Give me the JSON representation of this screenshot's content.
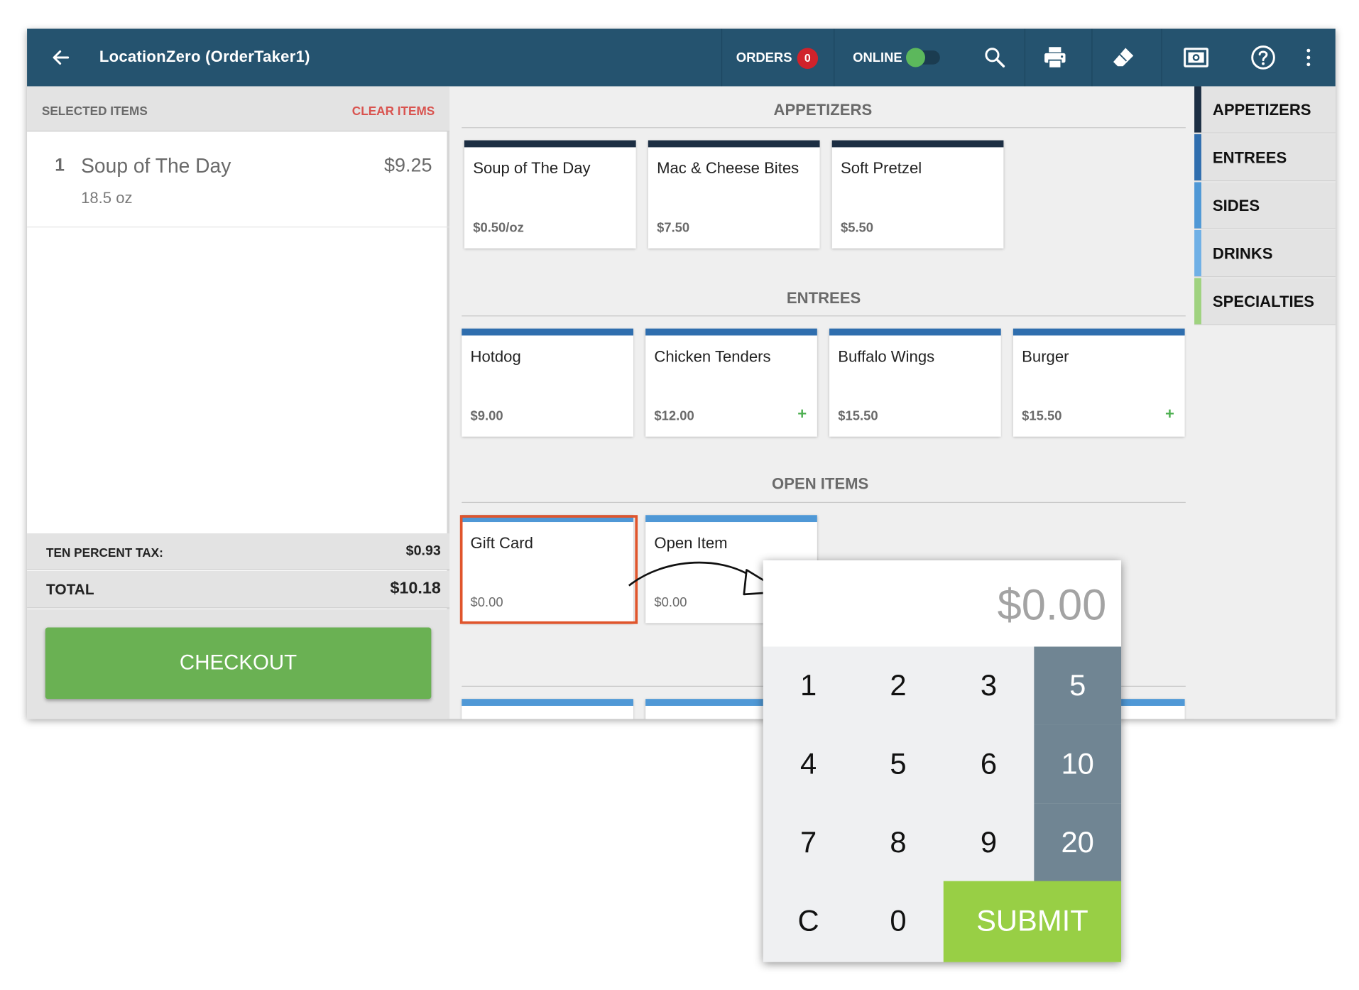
{
  "header": {
    "title": "LocationZero (OrderTaker1)",
    "orders_label": "ORDERS",
    "orders_count": "0",
    "online_label": "ONLINE",
    "online_on": true
  },
  "order": {
    "header_label": "SELECTED ITEMS",
    "clear_label": "CLEAR ITEMS",
    "items": [
      {
        "qty": "1",
        "name": "Soup of The Day",
        "price": "$9.25",
        "detail": "18.5 oz"
      }
    ],
    "tax_label": "TEN PERCENT TAX:",
    "tax_value": "$0.93",
    "total_label": "TOTAL",
    "total_value": "$10.18",
    "checkout_label": "CHECKOUT"
  },
  "sections": {
    "appetizers": {
      "title": "APPETIZERS",
      "items": [
        {
          "name": "Soup of The Day",
          "price": "$0.50/oz"
        },
        {
          "name": "Mac & Cheese Bites",
          "price": "$7.50"
        },
        {
          "name": "Soft Pretzel",
          "price": "$5.50"
        }
      ]
    },
    "entrees": {
      "title": "ENTREES",
      "items": [
        {
          "name": "Hotdog",
          "price": "$9.00",
          "plus": ""
        },
        {
          "name": "Chicken Tenders",
          "price": "$12.00",
          "plus": "+"
        },
        {
          "name": "Buffalo Wings",
          "price": "$15.50",
          "plus": ""
        },
        {
          "name": "Burger",
          "price": "$15.50",
          "plus": "+"
        }
      ]
    },
    "open_items": {
      "title": "OPEN ITEMS",
      "items": [
        {
          "name": "Gift Card",
          "price": "$0.00"
        },
        {
          "name": "Open Item",
          "price": "$0.00"
        }
      ]
    }
  },
  "categories": [
    {
      "label": "APPETIZERS",
      "color": "#1c2e43"
    },
    {
      "label": "ENTREES",
      "color": "#2f6eae"
    },
    {
      "label": "SIDES",
      "color": "#4f98d6"
    },
    {
      "label": "DRINKS",
      "color": "#6fb0e6"
    },
    {
      "label": "SPECIALTIES",
      "color": "#9fd27f"
    }
  ],
  "numpad": {
    "amount": "$0.00",
    "keys": [
      "1",
      "2",
      "3",
      "4",
      "5",
      "6",
      "7",
      "8",
      "9",
      "C",
      "0"
    ],
    "quick": [
      "5",
      "10",
      "20"
    ],
    "submit_label": "SUBMIT"
  },
  "colors": {
    "header": "#25536f",
    "checkout": "#6ab153",
    "submit": "#98cf45",
    "clear": "#d9534f",
    "highlight": "#e0552c",
    "badge": "#d0222b"
  },
  "icons": [
    "back-arrow-icon",
    "search-icon",
    "printer-icon",
    "eraser-icon",
    "camera-icon",
    "help-icon",
    "more-vert-icon",
    "curved-arrow-icon",
    "plus-icon"
  ]
}
